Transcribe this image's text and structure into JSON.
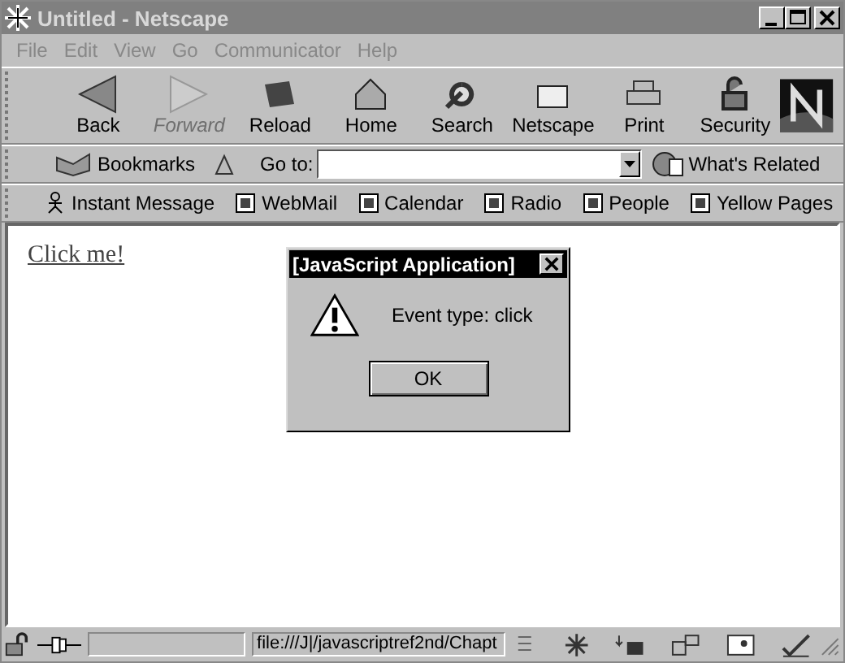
{
  "window": {
    "title": "Untitled - Netscape"
  },
  "menu": [
    {
      "label": "File"
    },
    {
      "label": "Edit"
    },
    {
      "label": "View"
    },
    {
      "label": "Go"
    },
    {
      "label": "Communicator"
    },
    {
      "label": "Help"
    }
  ],
  "toolbar": [
    {
      "label": "Back",
      "disabled": false
    },
    {
      "label": "Forward",
      "disabled": true
    },
    {
      "label": "Reload",
      "disabled": false
    },
    {
      "label": "Home",
      "disabled": false
    },
    {
      "label": "Search",
      "disabled": false
    },
    {
      "label": "Netscape",
      "disabled": false
    },
    {
      "label": "Print",
      "disabled": false
    },
    {
      "label": "Security",
      "disabled": false
    }
  ],
  "location_bar": {
    "bookmarks": "Bookmarks",
    "goto_label": "Go to:",
    "related": "What's Related"
  },
  "personal_bar": [
    {
      "label": "Instant Message",
      "kind": "person"
    },
    {
      "label": "WebMail",
      "kind": "page"
    },
    {
      "label": "Calendar",
      "kind": "page"
    },
    {
      "label": "Radio",
      "kind": "page"
    },
    {
      "label": "People",
      "kind": "page"
    },
    {
      "label": "Yellow Pages",
      "kind": "page"
    }
  ],
  "page": {
    "link": "Click me!"
  },
  "dialog": {
    "title": "[JavaScript Application]",
    "message": "Event type: click",
    "button": "OK"
  },
  "status_bar": {
    "url": "file:///J|/javascriptref2nd/Chapt"
  }
}
